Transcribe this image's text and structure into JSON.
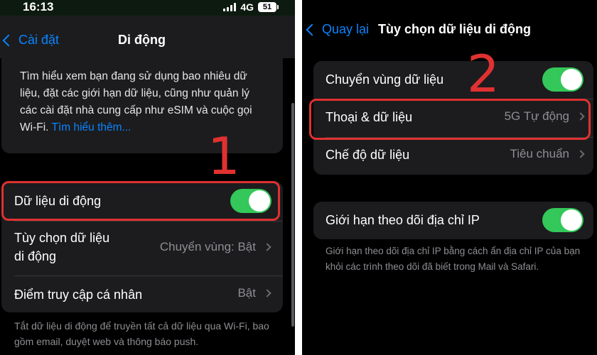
{
  "left": {
    "status": {
      "time": "16:13",
      "network": "4G",
      "battery": "51"
    },
    "nav": {
      "back_label": "Cài đặt",
      "title": "Di động"
    },
    "info": {
      "text": "Tìm hiểu xem bạn đang sử dụng bao nhiêu dữ liệu, đặt các giới hạn dữ liệu, cũng như quản lý các cài đặt nhà cung cấp như eSIM và cuộc gọi Wi-Fi.",
      "link": "Tìm hiểu thêm..."
    },
    "rows": {
      "cellular_data": "Dữ liệu di động",
      "data_options_line1": "Tùy chọn dữ liệu",
      "data_options_line2": "di động",
      "data_options_value": "Chuyển vùng: Bật",
      "hotspot": "Điểm truy cập cá nhân",
      "hotspot_value": "Bật"
    },
    "footnote": "Tắt dữ liệu di động để truyền tất cả dữ liệu qua Wi-Fi, bao gồm email, duyệt web và thông báo push.",
    "annotation_number": "1"
  },
  "right": {
    "nav": {
      "back_label": "Quay lại",
      "title": "Tùy chọn dữ liệu di động"
    },
    "rows": {
      "roaming": "Chuyển vùng dữ liệu",
      "voice_data": "Thoại & dữ liệu",
      "voice_data_value": "5G Tự động",
      "data_mode": "Chế độ dữ liệu",
      "data_mode_value": "Tiêu chuẩn",
      "ip_limit": "Giới hạn theo dõi địa chỉ IP"
    },
    "footnote": "Giới hạn theo dõi địa chỉ IP bằng cách ẩn địa chỉ IP của bạn khỏi các trình theo dõi đã biết trong Mail và Safari.",
    "annotation_number": "2"
  },
  "colors": {
    "accent": "#0a84ff",
    "toggle_on": "#34c759",
    "annotation": "#e03131",
    "cell_bg": "#1c1c1e"
  }
}
